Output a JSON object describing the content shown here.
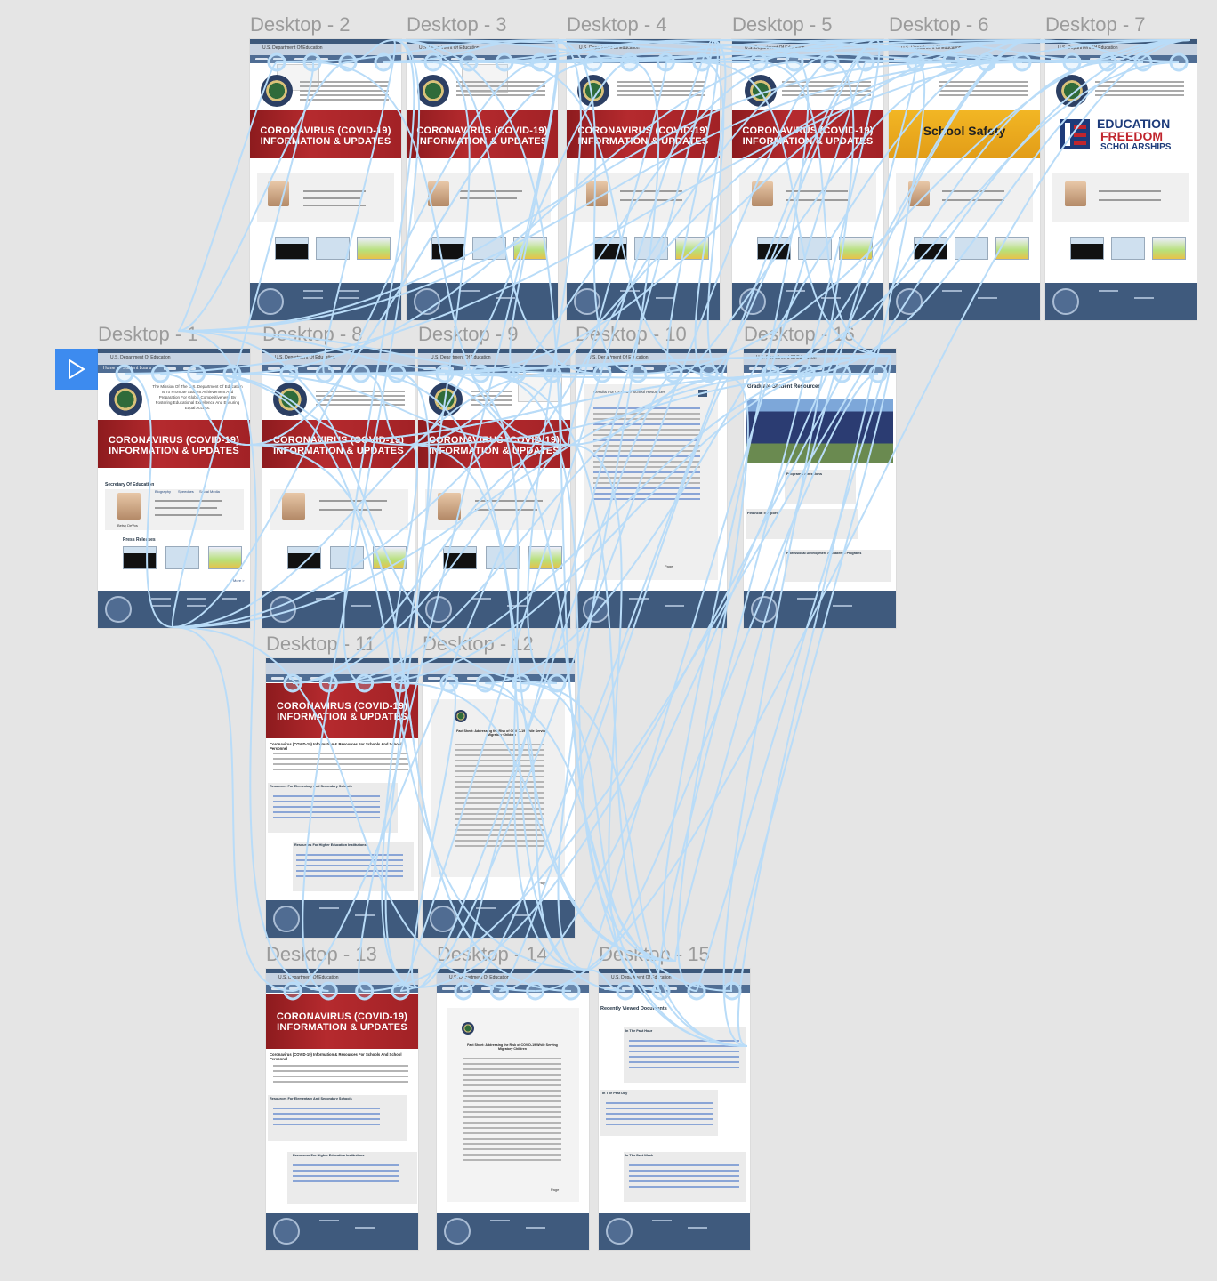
{
  "frames": [
    {
      "key": "d2",
      "label": "Desktop - 2",
      "variant": "home-dropdown"
    },
    {
      "key": "d3",
      "label": "Desktop - 3",
      "variant": "home-dropdown"
    },
    {
      "key": "d4",
      "label": "Desktop - 4",
      "variant": "home"
    },
    {
      "key": "d5",
      "label": "Desktop - 5",
      "variant": "home"
    },
    {
      "key": "d6",
      "label": "Desktop - 6",
      "variant": "home-school"
    },
    {
      "key": "d7",
      "label": "Desktop - 7",
      "variant": "home-efs"
    },
    {
      "key": "d1",
      "label": "Desktop - 1",
      "variant": "home"
    },
    {
      "key": "d8",
      "label": "Desktop - 8",
      "variant": "home"
    },
    {
      "key": "d9",
      "label": "Desktop - 9",
      "variant": "home"
    },
    {
      "key": "d10",
      "label": "Desktop - 10",
      "variant": "search"
    },
    {
      "key": "d16",
      "label": "Desktop - 16",
      "variant": "graduate"
    },
    {
      "key": "d11",
      "label": "Desktop - 11",
      "variant": "covid-page"
    },
    {
      "key": "d12",
      "label": "Desktop - 12",
      "variant": "document"
    },
    {
      "key": "d13",
      "label": "Desktop - 13",
      "variant": "covid-page"
    },
    {
      "key": "d14",
      "label": "Desktop - 14",
      "variant": "document"
    },
    {
      "key": "d15",
      "label": "Desktop - 15",
      "variant": "recent"
    }
  ],
  "site": {
    "department": "U.S. Department Of Education",
    "mission": "The Mission Of The U.S. Department Of Education Is To Promote Student Achievement And Preparation For Global Competitiveness By Fostering Educational Excellence And Ensuring Equal Access.",
    "banner": "CORONAVIRUS (COVID-19) INFORMATION & UPDATES",
    "school_banner": "School Safety",
    "school_sub": "Safe Schools, Adopt Quickly To Their Needs, Evolving To",
    "efs": {
      "line1": "EDUCATION",
      "line2": "FREEDOM",
      "line3": "SCHOLARSHIPS"
    },
    "secretary_title": "Secretary Of Education",
    "secretary_links": [
      "Biography",
      "Speeches",
      "Social Media"
    ],
    "secretary_name": "Betsy DeVos",
    "press_title": "Press Releases",
    "more": "More >",
    "nav_home": "Home",
    "nav_student": "Student Loans"
  },
  "pages": {
    "search_title": "Results For Graduate School Resources",
    "grad_title": "Graduate Student Resources",
    "grad_sections": [
      "Program Admissions",
      "Financial Support",
      "Professional Development & Academic Programs"
    ],
    "covid_title": "Coronavirus (COVID-19) Information & Resources For Schools And School Personnel",
    "covid_sections": [
      "Resources For Elementary And Secondary Schools",
      "Resources For Higher Education Institutions"
    ],
    "doc_head": "Fact Sheet: Addressing the Risk of COVID-19 While Serving Migratory Children",
    "page_label": "Page",
    "recent_title": "Recently Viewed Documents",
    "recent_sections": [
      "In The Past Hour",
      "In The Past Day",
      "In The Past Week"
    ]
  }
}
